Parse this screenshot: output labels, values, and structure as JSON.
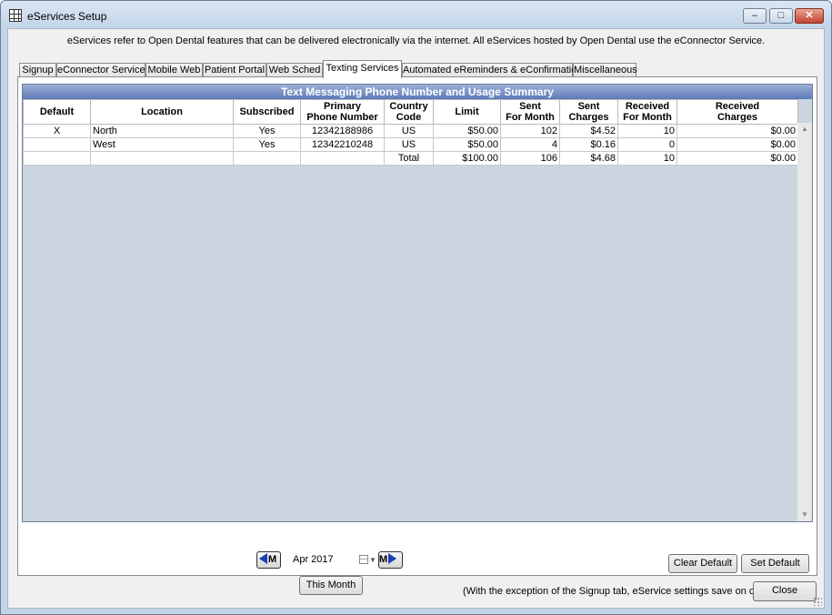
{
  "window": {
    "title": "eServices Setup",
    "minimize": "–",
    "maximize": "□",
    "close": "✕"
  },
  "description": "eServices refer to Open Dental features that can be delivered electronically via the internet.  All eServices hosted by Open Dental use the eConnector Service.",
  "tabs": [
    {
      "label": "Signup"
    },
    {
      "label": "eConnector Service"
    },
    {
      "label": "Mobile Web"
    },
    {
      "label": "Patient Portal"
    },
    {
      "label": "Web Sched"
    },
    {
      "label": "Texting Services",
      "active": true
    },
    {
      "label": "Automated eReminders & eConfirmations"
    },
    {
      "label": "Miscellaneous"
    }
  ],
  "grid": {
    "title": "Text Messaging Phone Number and Usage Summary",
    "columns": [
      {
        "line1": "Default",
        "line2": ""
      },
      {
        "line1": "Location",
        "line2": ""
      },
      {
        "line1": "Subscribed",
        "line2": ""
      },
      {
        "line1": "Primary",
        "line2": "Phone Number"
      },
      {
        "line1": "Country",
        "line2": "Code"
      },
      {
        "line1": "Limit",
        "line2": ""
      },
      {
        "line1": "Sent",
        "line2": "For Month"
      },
      {
        "line1": "Sent",
        "line2": "Charges"
      },
      {
        "line1": "Received",
        "line2": "For Month"
      },
      {
        "line1": "Received",
        "line2": "Charges"
      }
    ],
    "rows": [
      {
        "default": "X",
        "location": "North",
        "subscribed": "Yes",
        "phone": "12342188986",
        "country": "US",
        "limit": "$50.00",
        "sent": "102",
        "sent_charges": "$4.52",
        "received": "10",
        "received_charges": "$0.00"
      },
      {
        "default": "",
        "location": "West",
        "subscribed": "Yes",
        "phone": "12342210248",
        "country": "US",
        "limit": "$50.00",
        "sent": "4",
        "sent_charges": "$0.16",
        "received": "0",
        "received_charges": "$0.00"
      },
      {
        "default": "",
        "location": "",
        "subscribed": "",
        "phone": "",
        "country": "Total",
        "limit": "$100.00",
        "sent": "106",
        "sent_charges": "$4.68",
        "received": "10",
        "received_charges": "$0.00"
      }
    ],
    "scroll_up": "▲",
    "scroll_down": "▼"
  },
  "month_nav": {
    "prev_label": "M",
    "next_label": "M",
    "date_value": "Apr  2017",
    "this_month": "This Month"
  },
  "buttons": {
    "clear_default": "Clear Default",
    "set_default": "Set Default",
    "close": "Close"
  },
  "footer_note": "(With the exception of the Signup tab, eService settings save on close)",
  "colors": {
    "grid_title_bg": "#5d79b8",
    "arrow_blue": "#1a3fb5",
    "grid_empty_bg": "#cbd5df"
  }
}
